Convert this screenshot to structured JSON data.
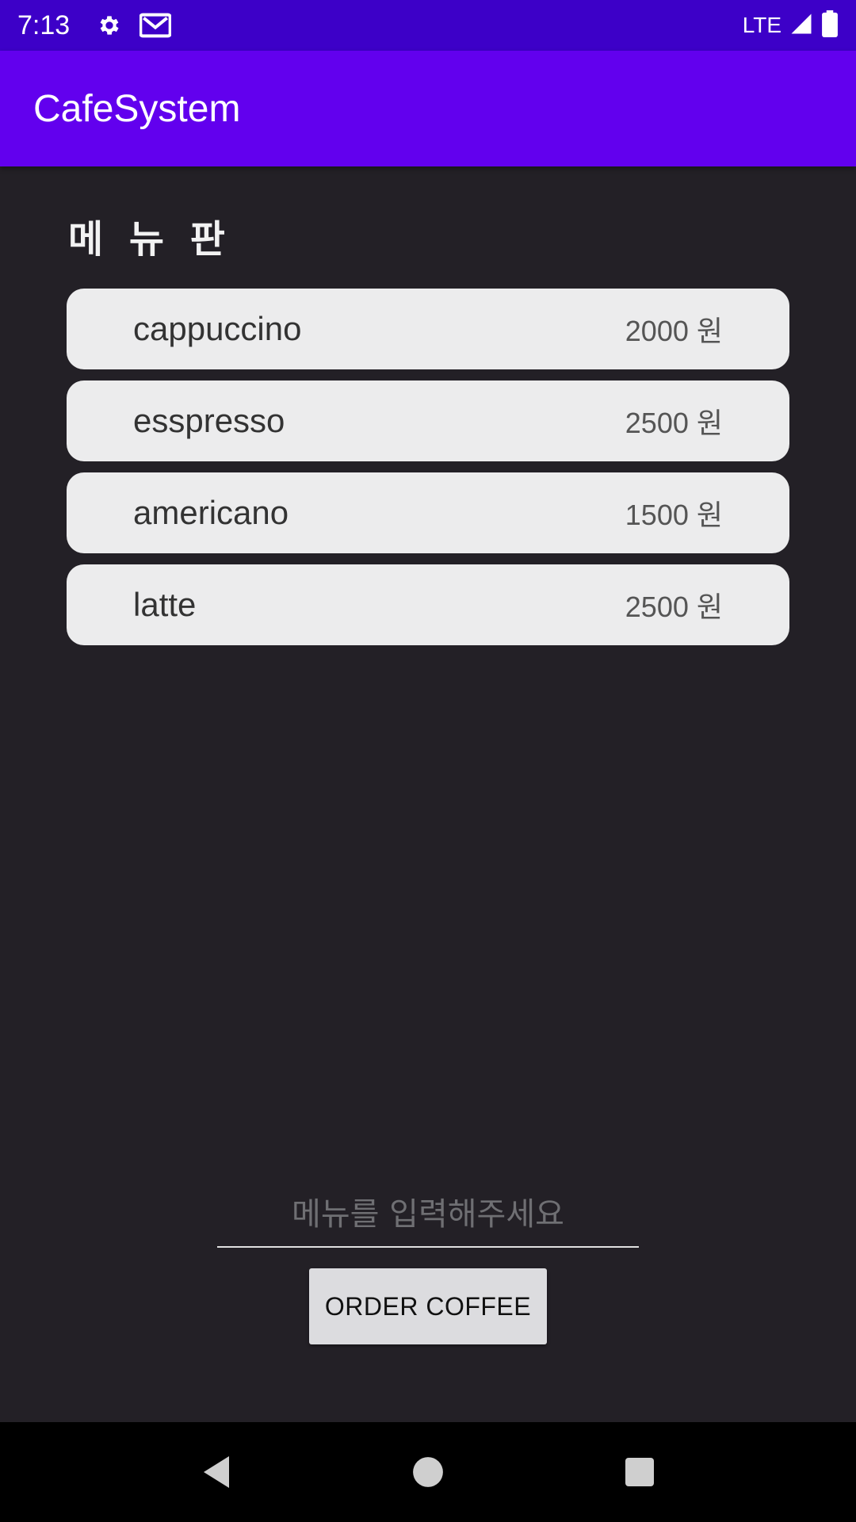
{
  "status_bar": {
    "time": "7:13",
    "icons": [
      "gear-icon",
      "gmail-icon"
    ],
    "network_label": "LTE",
    "right_icons": [
      "signal-icon",
      "battery-icon"
    ]
  },
  "app_bar": {
    "title": "CafeSystem",
    "color": "#6200ee"
  },
  "menu": {
    "heading": "메 뉴 판",
    "items": [
      {
        "name": "cappuccino",
        "price": "2000 원"
      },
      {
        "name": "esspresso",
        "price": "2500 원"
      },
      {
        "name": "americano",
        "price": "1500 원"
      },
      {
        "name": "latte",
        "price": "2500 원"
      }
    ]
  },
  "order": {
    "input_placeholder": "메뉴를 입력해주세요",
    "input_value": "",
    "button_label": "ORDER COFFEE"
  },
  "nav_bar": {
    "buttons": [
      "back-icon",
      "home-icon",
      "recents-icon"
    ]
  }
}
